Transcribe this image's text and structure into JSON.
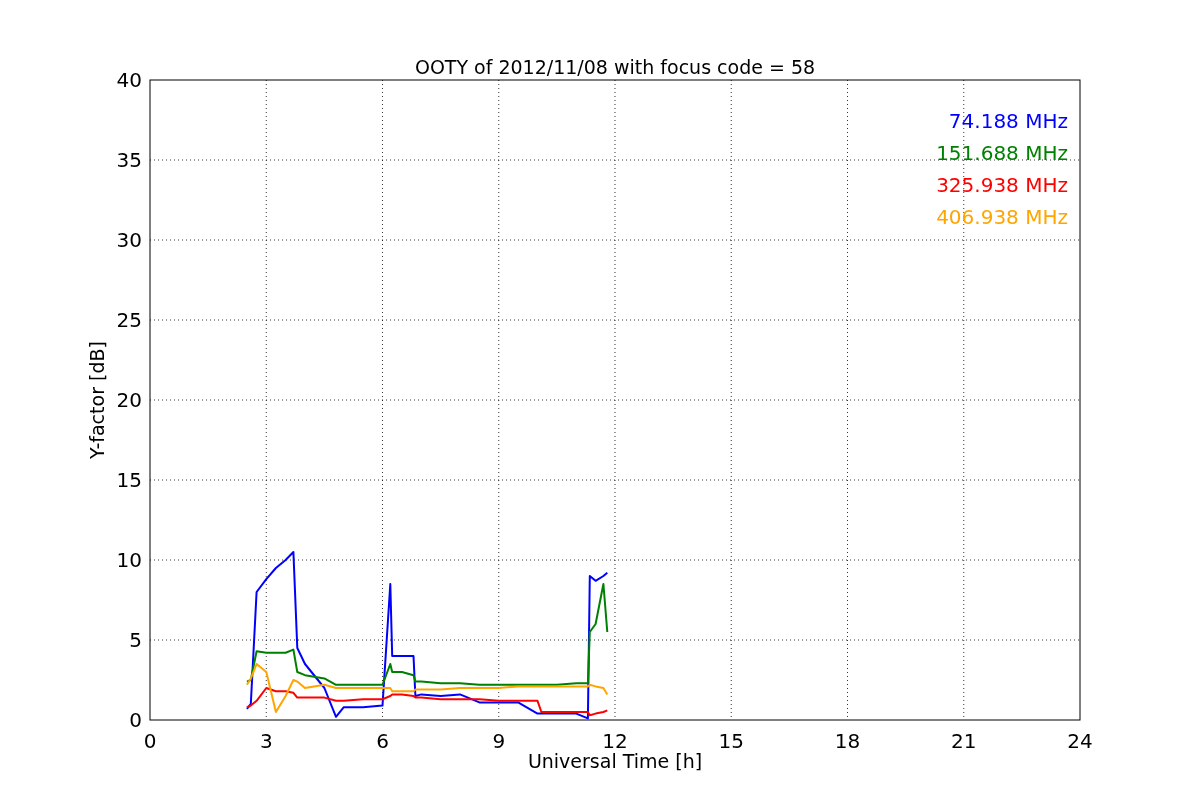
{
  "chart_data": {
    "type": "line",
    "title": "OOTY of 2012/11/08 with focus code = 58",
    "xlabel": "Universal Time [h]",
    "ylabel": "Y-factor [dB]",
    "x": [
      2.5,
      2.6,
      2.75,
      3.0,
      3.25,
      3.5,
      3.7,
      3.8,
      4.0,
      4.5,
      4.8,
      5.0,
      5.5,
      6.0,
      6.2,
      6.25,
      6.5,
      6.8,
      6.85,
      7.0,
      7.5,
      8.0,
      8.5,
      9.0,
      9.5,
      10.0,
      10.1,
      10.5,
      11.0,
      11.3,
      11.35,
      11.5,
      11.7,
      11.8
    ],
    "series": [
      {
        "name": "74.188 MHz",
        "color": "#0000ff",
        "values": [
          0.7,
          1.0,
          8.0,
          8.8,
          9.5,
          10.0,
          10.5,
          4.5,
          3.5,
          2.0,
          0.2,
          0.8,
          0.8,
          0.9,
          8.5,
          4.0,
          4.0,
          4.0,
          1.5,
          1.6,
          1.5,
          1.6,
          1.1,
          1.1,
          1.1,
          0.4,
          0.4,
          0.4,
          0.4,
          0.1,
          9.0,
          8.7,
          9.0,
          9.2
        ]
      },
      {
        "name": "151.688 MHz",
        "color": "#008000",
        "values": [
          2.4,
          2.5,
          4.3,
          4.2,
          4.2,
          4.2,
          4.4,
          3.0,
          2.8,
          2.6,
          2.2,
          2.2,
          2.2,
          2.2,
          3.5,
          3.0,
          3.0,
          2.8,
          2.4,
          2.4,
          2.3,
          2.3,
          2.2,
          2.2,
          2.2,
          2.2,
          2.2,
          2.2,
          2.3,
          2.3,
          5.5,
          6.0,
          8.5,
          5.5
        ]
      },
      {
        "name": "325.938 MHz",
        "color": "#ff0000",
        "values": [
          0.8,
          0.9,
          1.2,
          2.0,
          1.8,
          1.8,
          1.7,
          1.4,
          1.4,
          1.4,
          1.2,
          1.2,
          1.3,
          1.3,
          1.5,
          1.6,
          1.6,
          1.5,
          1.4,
          1.4,
          1.3,
          1.3,
          1.3,
          1.2,
          1.2,
          1.2,
          0.5,
          0.5,
          0.5,
          0.5,
          0.3,
          0.4,
          0.5,
          0.6
        ]
      },
      {
        "name": "406.938 MHz",
        "color": "#ffa500",
        "values": [
          2.2,
          2.6,
          3.5,
          3.0,
          0.5,
          1.5,
          2.5,
          2.4,
          2.0,
          2.2,
          2.0,
          2.0,
          2.0,
          2.0,
          2.0,
          1.8,
          1.8,
          1.8,
          1.9,
          1.9,
          1.9,
          2.0,
          2.0,
          2.0,
          2.1,
          2.1,
          2.1,
          2.1,
          2.1,
          2.1,
          2.2,
          2.1,
          2.0,
          1.6
        ]
      }
    ],
    "xlim": [
      0,
      24
    ],
    "ylim": [
      0,
      40
    ],
    "xticks": [
      0,
      3,
      6,
      9,
      12,
      15,
      18,
      21,
      24
    ],
    "yticks": [
      0,
      5,
      10,
      15,
      20,
      25,
      30,
      35,
      40
    ],
    "grid": true
  }
}
